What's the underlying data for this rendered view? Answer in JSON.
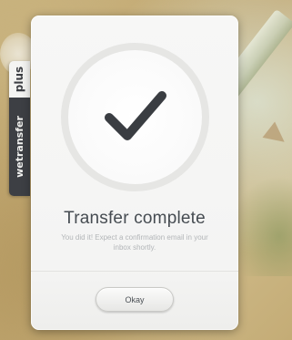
{
  "side_tab": {
    "plus_label": "plus",
    "brand_label": "wetransfer"
  },
  "dialog": {
    "icon": "checkmark-icon",
    "title": "Transfer complete",
    "message": "You did it! Expect a confirmation email in your inbox shortly.",
    "okay_label": "Okay"
  },
  "colors": {
    "check": "#3a3d42",
    "ring": "#e6e6e4",
    "card": "#f6f6f5",
    "tab_dark": "#3d3f44",
    "tab_light": "#f4f4f2"
  }
}
